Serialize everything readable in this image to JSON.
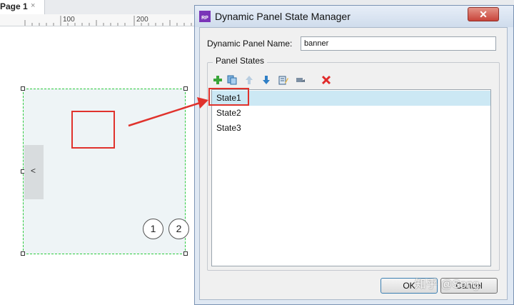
{
  "editor": {
    "page_tab": "Page 1",
    "page_tab_close": "×",
    "ruler_labels": [
      "100",
      "200"
    ],
    "prev_arrow": "<",
    "pager_dots": [
      "1",
      "2"
    ]
  },
  "dialog": {
    "title": "Dynamic Panel State Manager",
    "app_icon_text": "RP",
    "close_glyph": "✕",
    "name_label": "Dynamic Panel Name:",
    "name_value": "banner",
    "group_label": "Panel States",
    "toolbar": {
      "add": "add-state",
      "duplicate": "duplicate-state",
      "move_up": "move-up",
      "move_down": "move-down",
      "edit": "edit-state",
      "edit_all": "edit-all-states",
      "delete": "delete-state"
    },
    "states": [
      "State1",
      "State2",
      "State3"
    ],
    "selected_index": 0,
    "ok_label": "OK",
    "cancel_label": "Cancel"
  },
  "watermark": "知乎 @Song",
  "colors": {
    "annotation_red": "#e0322c",
    "selection_blue": "#cce8f4",
    "panel_dash_green": "#2ecc40"
  }
}
